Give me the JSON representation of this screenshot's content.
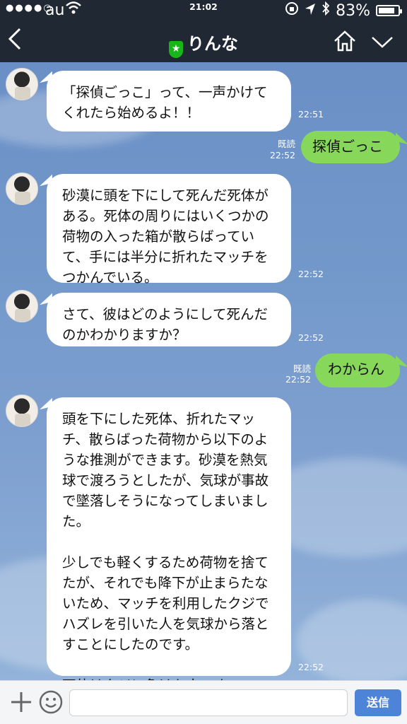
{
  "status": {
    "carrier": "au",
    "time": "21:02",
    "battery_text": "83%",
    "battery_level": 0.83
  },
  "header": {
    "title": "りんな",
    "badge_icon": "star-icon"
  },
  "messages": [
    {
      "side": "left",
      "text": "「探偵ごっこ」って、一声かけて\nくれたら始めるよ！！",
      "time": "22:51"
    },
    {
      "side": "right",
      "text": "探偵ごっこ",
      "read": "既読",
      "time": "22:52"
    },
    {
      "side": "left",
      "text": "砂漠に頭を下にして死んだ死体が\nある。死体の周りにはいくつかの\n荷物の入った箱が散らばってい\nて、手には半分に折れたマッチを\nつかんでいる。",
      "time": "22:52"
    },
    {
      "side": "left",
      "text": "さて、彼はどのようにして死んだ\nのかわかりますか？",
      "time": "22:52"
    },
    {
      "side": "right",
      "text": "わからん",
      "read": "既読",
      "time": "22:52"
    },
    {
      "side": "left",
      "text": "頭を下にした死体、折れたマッ\nチ、散らばった荷物から以下のよ\nうな推測ができます。砂漠を熱気\n球で渡ろうとしたが、気球が事故\nで墜落しそうになってしまいまし\nた。\n\n少しでも軽くするため荷物を捨て\nたが、それでも降下が止まらたな\nいため、マッチを利用したクジで\nハズレを引いた人を気球から落と\nすことにしたのです。\n\n死体はクジに負けた人です。",
      "time": "22:52"
    }
  ],
  "input": {
    "placeholder": "",
    "send_label": "送信"
  },
  "colors": {
    "header_bg": "#1f2833",
    "my_bubble": "#86d75a",
    "their_bubble": "#ffffff",
    "send_button": "#4e84d8"
  }
}
